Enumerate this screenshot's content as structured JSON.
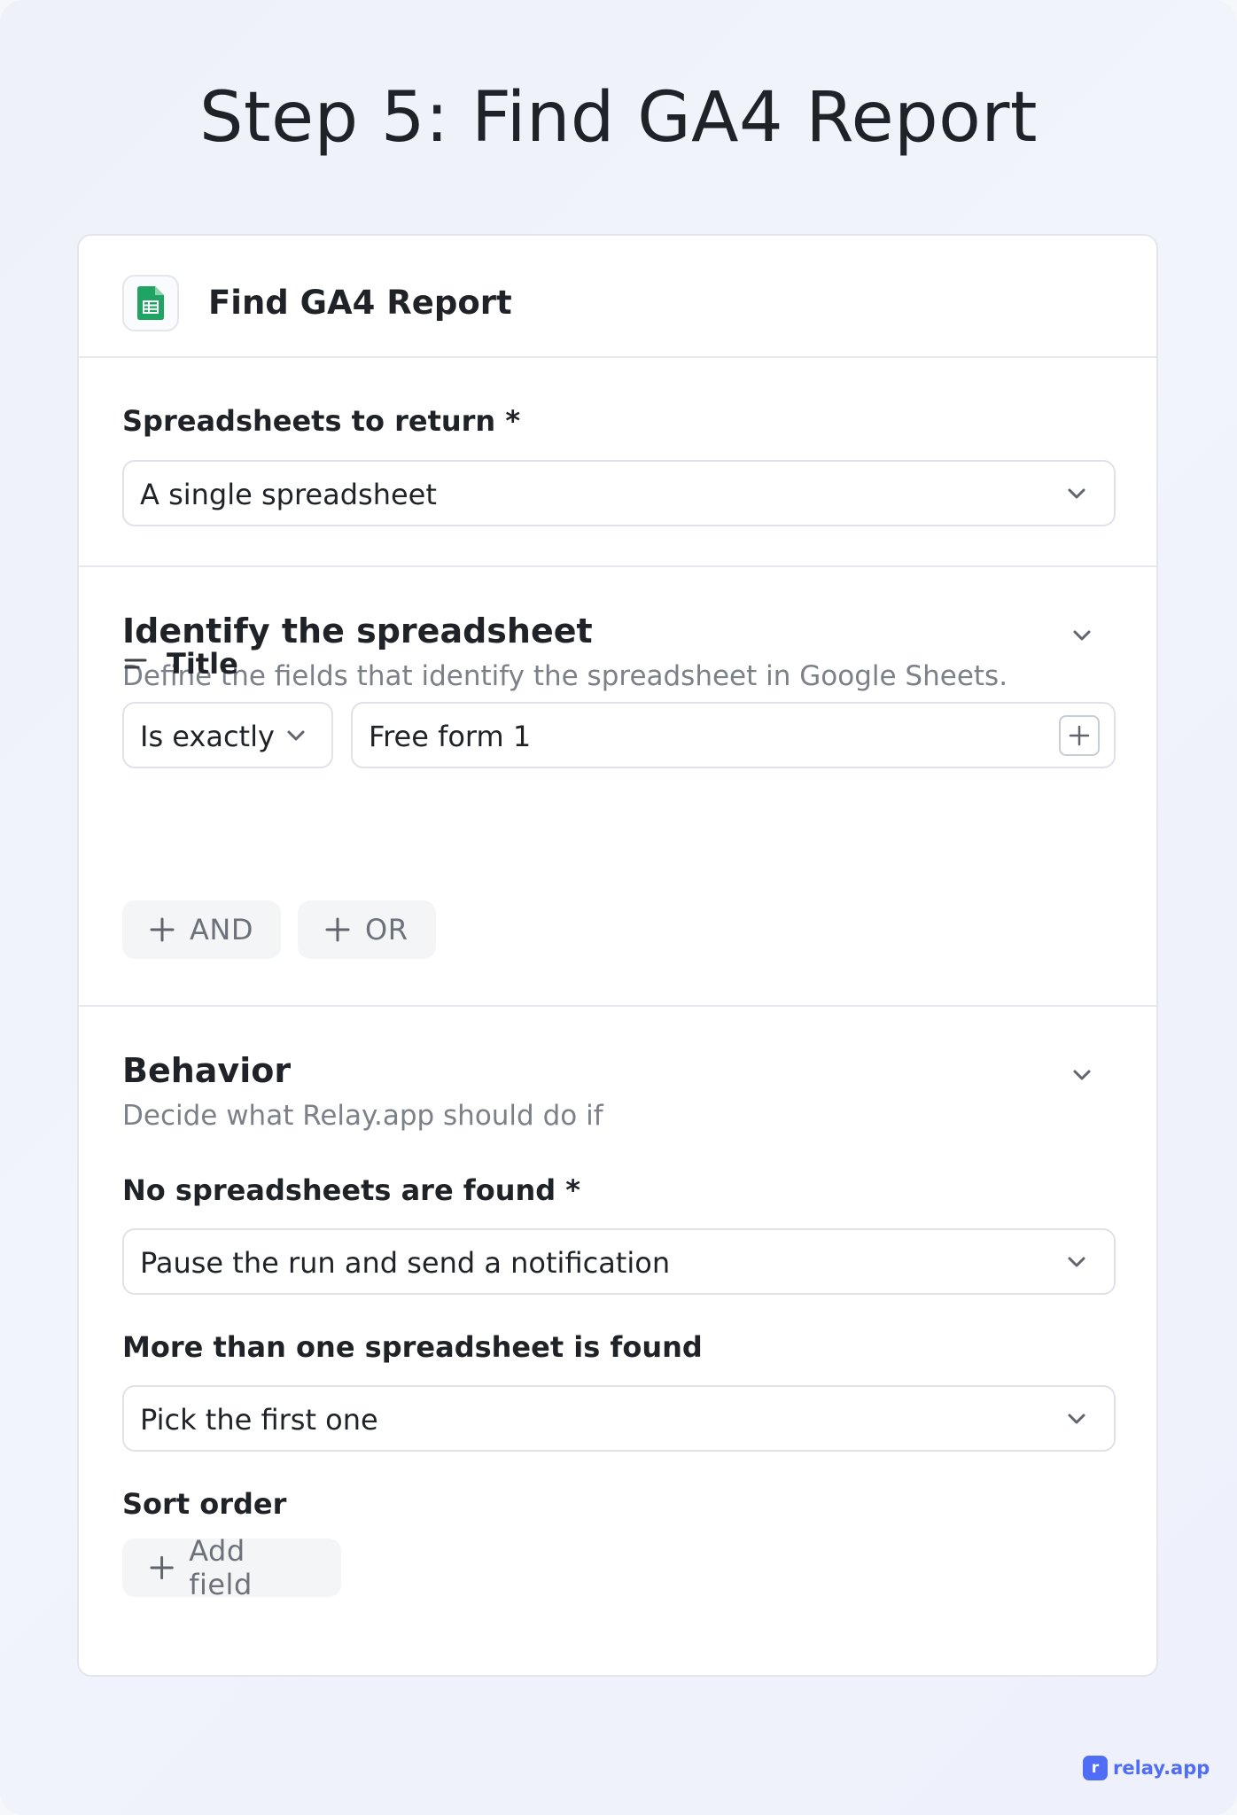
{
  "page": {
    "heading": "Step 5: Find GA4 Report"
  },
  "card": {
    "app_icon": "google-sheets-icon",
    "title": "Find GA4 Report"
  },
  "spreadsheets_to_return": {
    "label": "Spreadsheets to return",
    "required_mark": "*",
    "value": "A single spreadsheet"
  },
  "identify": {
    "title": "Identify the spreadsheet",
    "subtitle": "Define the fields that identify the spreadsheet in Google Sheets.",
    "field_label": "Title",
    "operator": "Is exactly",
    "value": "Free form 1",
    "and_label": "AND",
    "or_label": "OR"
  },
  "behavior": {
    "title": "Behavior",
    "subtitle": "Decide what Relay.app should do if",
    "none_found": {
      "label": "No spreadsheets are found",
      "required_mark": "*",
      "value": "Pause the run and send a notification"
    },
    "multiple_found": {
      "label": "More than one spreadsheet is found",
      "value": "Pick the first one"
    },
    "sort_order": {
      "label": "Sort order",
      "add_label": "Add field"
    }
  },
  "brand": {
    "mark": "r",
    "name": "relay.app",
    "color": "#4f6df5"
  },
  "colors": {
    "sheets_green": "#1fa463",
    "text": "#1f2328",
    "muted": "#7b8089"
  }
}
